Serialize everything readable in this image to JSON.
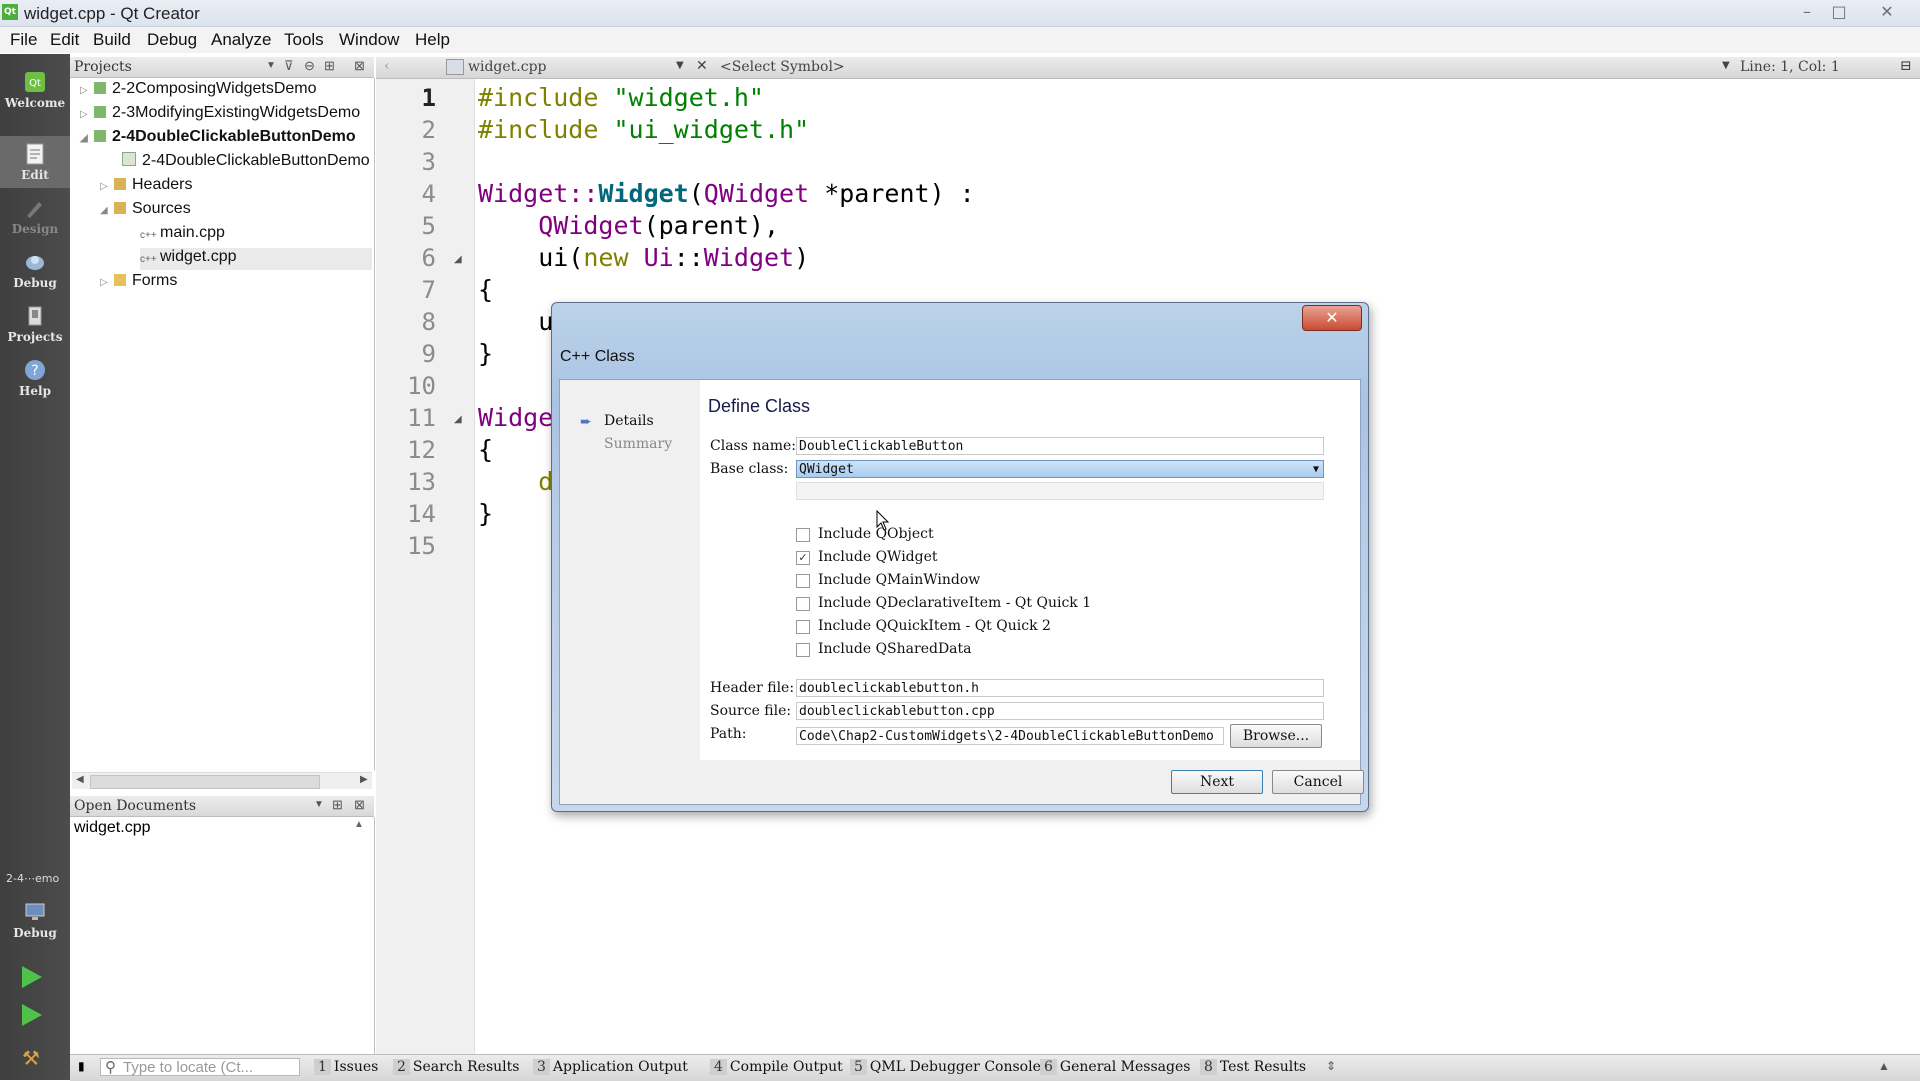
{
  "window": {
    "title": "widget.cpp - Qt Creator",
    "app_icon": "Qt",
    "controls": [
      "minimize-icon",
      "maximize-icon",
      "close-icon"
    ]
  },
  "menu": [
    "File",
    "Edit",
    "Build",
    "Debug",
    "Analyze",
    "Tools",
    "Window",
    "Help"
  ],
  "modes": [
    {
      "label": "Welcome",
      "icon": "qt-logo-icon"
    },
    {
      "label": "Edit",
      "icon": "edit-document-icon"
    },
    {
      "label": "Design",
      "icon": "design-pencil-icon"
    },
    {
      "label": "Debug",
      "icon": "debug-bug-icon"
    },
    {
      "label": "Projects",
      "icon": "projects-wrench-icon"
    },
    {
      "label": "Help",
      "icon": "help-question-icon"
    }
  ],
  "kit": {
    "project": "2-4⋯emo",
    "label": "Debug"
  },
  "projects": {
    "header": "Projects",
    "tree": [
      "2-2ComposingWidgetsDemo",
      "2-3ModifyingExistingWidgetsDemo",
      "2-4DoubleClickableButtonDemo",
      "2-4DoubleClickableButtonDemo",
      "Headers",
      "Sources",
      "main.cpp",
      "widget.cpp",
      "Forms"
    ]
  },
  "open_documents": {
    "header": "Open Documents",
    "items": [
      "widget.cpp"
    ]
  },
  "editor": {
    "file_tab": "widget.cpp",
    "symbol": "<Select Symbol>",
    "position": "Line: 1, Col: 1",
    "line_numbers": [
      "1",
      "2",
      "3",
      "4",
      "5",
      "6",
      "7",
      "8",
      "9",
      "10",
      "11",
      "12",
      "13",
      "14",
      "15"
    ],
    "lines": {
      "l1a": "#include",
      "l1b": " \"widget.h\"",
      "l2a": "#include",
      "l2b": " \"ui_widget.h\"",
      "l4a": "Widget::",
      "l4b": "Widget",
      "l4c": "(",
      "l4d": "QWidget",
      "l4e": " *parent) :",
      "l5a": "    ",
      "l5b": "QWidget",
      "l5c": "(parent),",
      "l6a": "    ui(",
      "l6b": "new",
      "l6c": " ",
      "l6d": "Ui",
      "l6e": "::",
      "l6f": "Widget",
      "l6g": ")",
      "l7": "{",
      "l8": "    u",
      "l9": "}",
      "l11": "Widge",
      "l12": "{",
      "l13": "    d",
      "l14": "}"
    }
  },
  "dialog": {
    "title": "C++ Class",
    "nav": [
      "Details",
      "Summary"
    ],
    "heading": "Define Class",
    "class_name_label": "Class name:",
    "class_name": "DoubleClickableButton",
    "base_class_label": "Base class:",
    "base_class": "QWidget",
    "includes": [
      {
        "label": "Include QObject",
        "checked": false
      },
      {
        "label": "Include QWidget",
        "checked": true
      },
      {
        "label": "Include QMainWindow",
        "checked": false
      },
      {
        "label": "Include QDeclarativeItem - Qt Quick 1",
        "checked": false
      },
      {
        "label": "Include QQuickItem - Qt Quick 2",
        "checked": false
      },
      {
        "label": "Include QSharedData",
        "checked": false
      }
    ],
    "header_file_label": "Header file:",
    "header_file": "doubleclickablebutton.h",
    "source_file_label": "Source file:",
    "source_file": "doubleclickablebutton.cpp",
    "path_label": "Path:",
    "path": "Code\\Chap2-CustomWidgets\\2-4DoubleClickableButtonDemo",
    "browse": "Browse...",
    "next": "Next",
    "cancel": "Cancel",
    "close_glyph": "✕"
  },
  "status": {
    "locator_placeholder": "Type to locate (Ct...",
    "tabs": [
      {
        "num": "1",
        "label": "Issues"
      },
      {
        "num": "2",
        "label": "Search Results"
      },
      {
        "num": "3",
        "label": "Application Output"
      },
      {
        "num": "4",
        "label": "Compile Output"
      },
      {
        "num": "5",
        "label": "QML Debugger Console"
      },
      {
        "num": "6",
        "label": "General Messages"
      },
      {
        "num": "8",
        "label": "Test Results"
      }
    ]
  },
  "colors": {
    "keyword": "#808000",
    "string": "#008000",
    "function": "#00677c",
    "type": "#800080",
    "accent": "#4cae3b"
  }
}
